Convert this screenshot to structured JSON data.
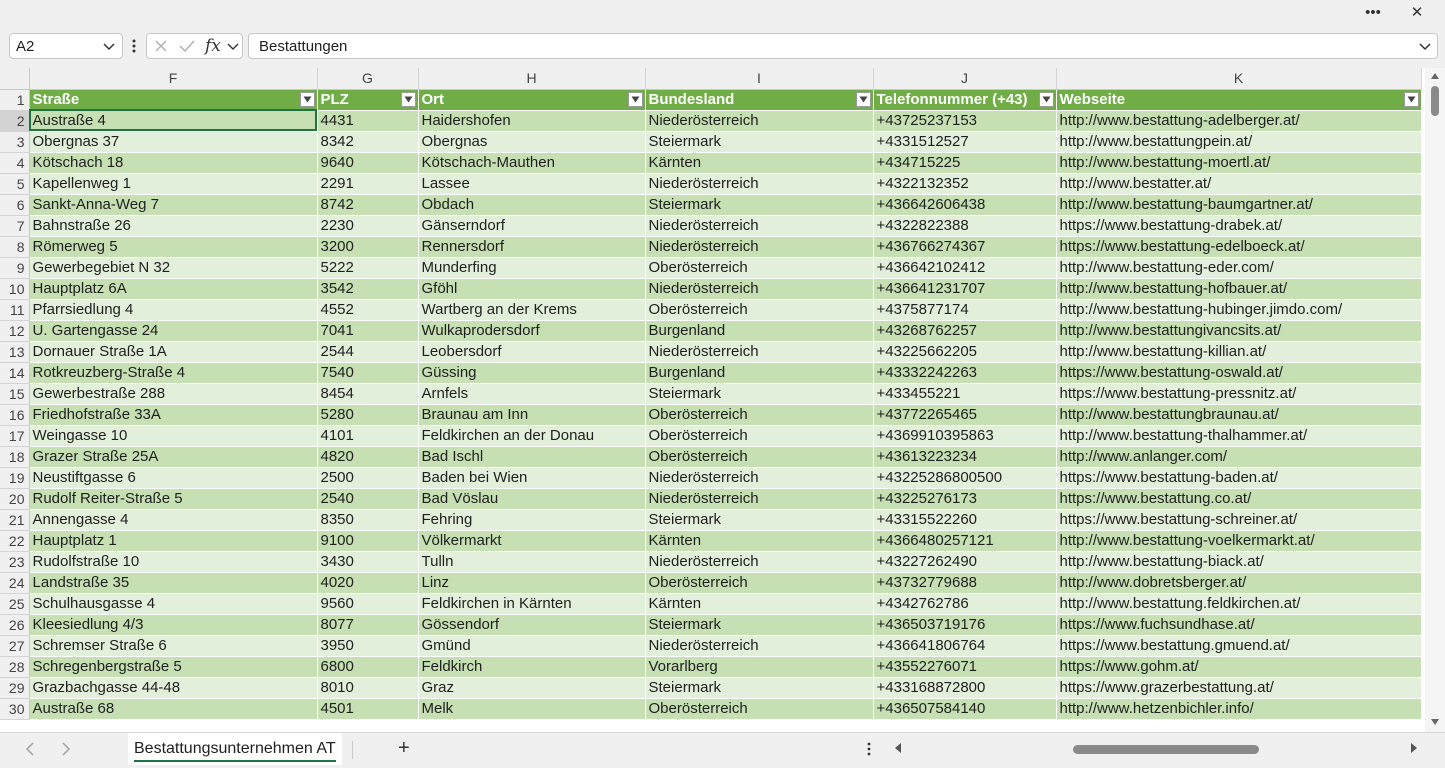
{
  "topbar": {
    "more_label": "•••",
    "close_label": "✕"
  },
  "formula_bar": {
    "name_box": "A2",
    "fx_label": "fx",
    "formula_value": "Bestattungen"
  },
  "columns": [
    "F",
    "G",
    "H",
    "I",
    "J",
    "K"
  ],
  "header_row": {
    "number": "1",
    "cells": [
      "Straße",
      "PLZ",
      "Ort",
      "Bundesland",
      "Telefonnummer (+43)",
      "Webseite"
    ]
  },
  "rows": [
    {
      "n": "2",
      "c": [
        "Austraße 4",
        "4431",
        "Haidershofen",
        "Niederösterreich",
        "+43725237153",
        "http://www.bestattung-adelberger.at/"
      ]
    },
    {
      "n": "3",
      "c": [
        "Obergnas 37",
        "8342",
        "Obergnas",
        "Steiermark",
        "+4331512527",
        "http://www.bestattungpein.at/"
      ]
    },
    {
      "n": "4",
      "c": [
        "Kötschach 18",
        "9640",
        "Kötschach-Mauthen",
        "Kärnten",
        "+434715225",
        "http://www.bestattung-moertl.at/"
      ]
    },
    {
      "n": "5",
      "c": [
        "Kapellenweg 1",
        "2291",
        "Lassee",
        "Niederösterreich",
        "+4322132352",
        "http://www.bestatter.at/"
      ]
    },
    {
      "n": "6",
      "c": [
        "Sankt-Anna-Weg 7",
        "8742",
        "Obdach",
        "Steiermark",
        "+436642606438",
        "http://www.bestattung-baumgartner.at/"
      ]
    },
    {
      "n": "7",
      "c": [
        "Bahnstraße 26",
        "2230",
        "Gänserndorf",
        "Niederösterreich",
        "+4322822388",
        "https://www.bestattung-drabek.at/"
      ]
    },
    {
      "n": "8",
      "c": [
        "Römerweg 5",
        "3200",
        "Rennersdorf",
        "Niederösterreich",
        "+436766274367",
        "https://www.bestattung-edelboeck.at/"
      ]
    },
    {
      "n": "9",
      "c": [
        "Gewerbegebiet N 32",
        "5222",
        "Munderfing",
        "Oberösterreich",
        "+436642102412",
        "http://www.bestattung-eder.com/"
      ]
    },
    {
      "n": "10",
      "c": [
        "Hauptplatz 6A",
        "3542",
        "Gföhl",
        "Niederösterreich",
        "+436641231707",
        "http://www.bestattung-hofbauer.at/"
      ]
    },
    {
      "n": "11",
      "c": [
        "Pfarrsiedlung 4",
        "4552",
        "Wartberg an der Krems",
        "Oberösterreich",
        "+4375877174",
        "http://www.bestattung-hubinger.jimdo.com/"
      ]
    },
    {
      "n": "12",
      "c": [
        "U. Gartengasse 24",
        "7041",
        "Wulkaprodersdorf",
        "Burgenland",
        "+43268762257",
        "http://www.bestattungivancsits.at/"
      ]
    },
    {
      "n": "13",
      "c": [
        "Dornauer Straße 1A",
        "2544",
        "Leobersdorf",
        "Niederösterreich",
        "+43225662205",
        "http://www.bestattung-killian.at/"
      ]
    },
    {
      "n": "14",
      "c": [
        "Rotkreuzberg-Straße 4",
        "7540",
        "Güssing",
        "Burgenland",
        "+43332242263",
        "https://www.bestattung-oswald.at/"
      ]
    },
    {
      "n": "15",
      "c": [
        "Gewerbestraße 288",
        "8454",
        "Arnfels",
        "Steiermark",
        "+433455221",
        "https://www.bestattung-pressnitz.at/"
      ]
    },
    {
      "n": "16",
      "c": [
        "Friedhofstraße 33A",
        "5280",
        "Braunau am Inn",
        "Oberösterreich",
        "+43772265465",
        "http://www.bestattungbraunau.at/"
      ]
    },
    {
      "n": "17",
      "c": [
        "Weingasse 10",
        "4101",
        "Feldkirchen an der Donau",
        "Oberösterreich",
        "+4369910395863",
        "http://www.bestattung-thalhammer.at/"
      ]
    },
    {
      "n": "18",
      "c": [
        "Grazer Straße 25A",
        "4820",
        "Bad Ischl",
        "Oberösterreich",
        "+43613223234",
        "http://www.anlanger.com/"
      ]
    },
    {
      "n": "19",
      "c": [
        "Neustiftgasse 6",
        "2500",
        "Baden bei Wien",
        "Niederösterreich",
        "+43225286800500",
        "https://www.bestattung-baden.at/"
      ]
    },
    {
      "n": "20",
      "c": [
        "Rudolf Reiter-Straße 5",
        "2540",
        "Bad Vöslau",
        "Niederösterreich",
        "+43225276173",
        "https://www.bestattung.co.at/"
      ]
    },
    {
      "n": "21",
      "c": [
        "Annengasse 4",
        "8350",
        "Fehring",
        "Steiermark",
        "+43315522260",
        "https://www.bestattung-schreiner.at/"
      ]
    },
    {
      "n": "22",
      "c": [
        "Hauptplatz 1",
        "9100",
        "Völkermarkt",
        "Kärnten",
        "+4366480257121",
        "http://www.bestattung-voelkermarkt.at/"
      ]
    },
    {
      "n": "23",
      "c": [
        "Rudolfstraße 10",
        "3430",
        "Tulln",
        "Niederösterreich",
        "+43227262490",
        "http://www.bestattung-biack.at/"
      ]
    },
    {
      "n": "24",
      "c": [
        "Landstraße 35",
        "4020",
        "Linz",
        "Oberösterreich",
        "+43732779688",
        "http://www.dobretsberger.at/"
      ]
    },
    {
      "n": "25",
      "c": [
        "Schulhausgasse 4",
        "9560",
        "Feldkirchen in Kärnten",
        "Kärnten",
        "+4342762786",
        "http://www.bestattung.feldkirchen.at/"
      ]
    },
    {
      "n": "26",
      "c": [
        "Kleesiedlung 4/3",
        "8077",
        "Gössendorf",
        "Steiermark",
        "+436503719176",
        "https://www.fuchsundhase.at/"
      ]
    },
    {
      "n": "27",
      "c": [
        "Schremser Straße 6",
        "3950",
        "Gmünd",
        "Niederösterreich",
        "+436641806764",
        "https://www.bestattung.gmuend.at/"
      ]
    },
    {
      "n": "28",
      "c": [
        "Schregenbergstraße 5",
        "6800",
        "Feldkirch",
        "Vorarlberg",
        "+43552276071",
        "https://www.gohm.at/"
      ]
    },
    {
      "n": "29",
      "c": [
        "Grazbachgasse 44-48",
        "8010",
        "Graz",
        "Steiermark",
        "+433168872800",
        "https://www.grazerbestattung.at/"
      ]
    },
    {
      "n": "30",
      "c": [
        "Austraße 68",
        "4501",
        "Melk",
        "Oberösterreich",
        "+436507584140",
        "http://www.hetzenbichler.info/"
      ]
    }
  ],
  "sheet_tabs": {
    "active": "Bestattungsunternehmen AT",
    "add_label": "+"
  },
  "colors": {
    "header_green": "#70ad47",
    "band_dark": "#c6e0b4",
    "band_light": "#e2efda",
    "excel_green": "#217346"
  }
}
